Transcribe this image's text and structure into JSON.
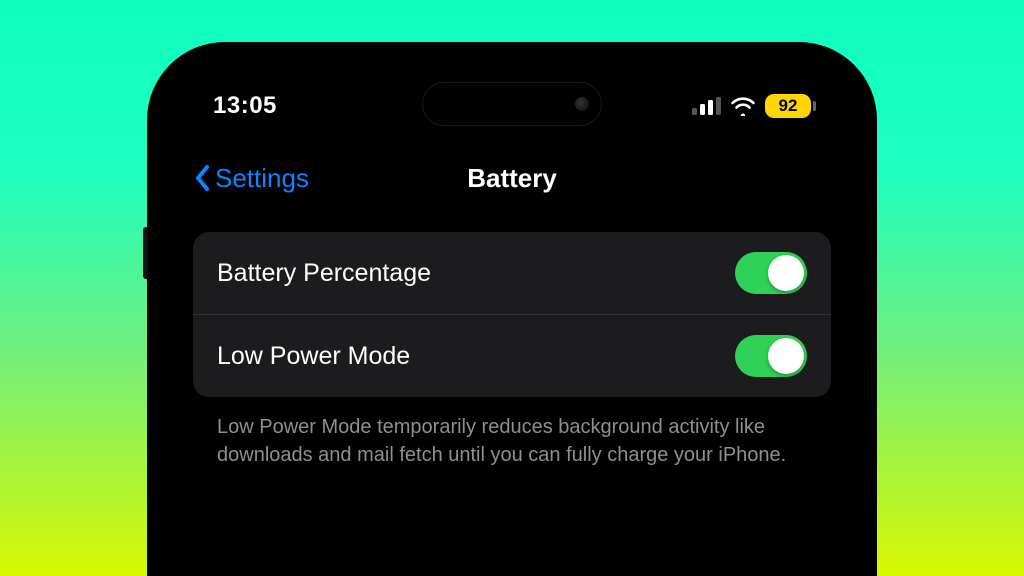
{
  "status": {
    "time": "13:05",
    "battery_percent": "92"
  },
  "nav": {
    "back_label": "Settings",
    "title": "Battery"
  },
  "rows": {
    "battery_percentage_label": "Battery Percentage",
    "low_power_mode_label": "Low Power Mode"
  },
  "footer": {
    "low_power_description": "Low Power Mode temporarily reduces background activity like downloads and mail fetch until you can fully charge your iPhone."
  },
  "colors": {
    "accent_blue": "#0a84ff",
    "toggle_green": "#30d158",
    "battery_yellow": "#fdd600"
  }
}
